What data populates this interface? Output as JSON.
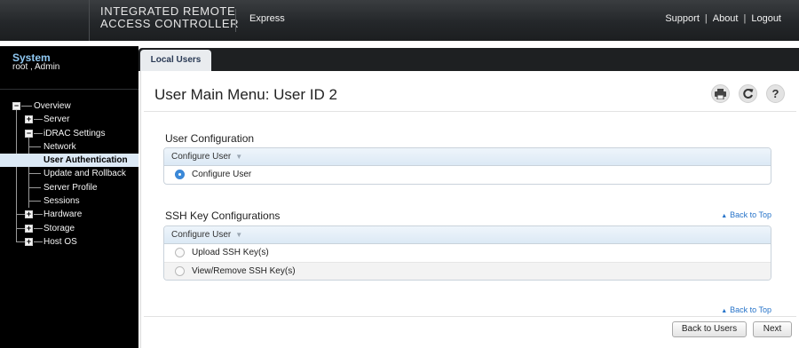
{
  "header": {
    "brand_line1": "INTEGRATED REMOTE",
    "brand_line2": "ACCESS CONTROLLER",
    "product": "Express",
    "links": {
      "support": "Support",
      "about": "About",
      "logout": "Logout",
      "separator": "|"
    }
  },
  "sidebar": {
    "title": "System",
    "user": "root , Admin",
    "tree": [
      {
        "label": "Overview",
        "expander": "−",
        "selected": false
      },
      {
        "label": "Server",
        "expander": "+",
        "selected": false
      },
      {
        "label": "iDRAC Settings",
        "expander": "−",
        "selected": false
      },
      {
        "label": "Network",
        "expander": "",
        "selected": false
      },
      {
        "label": "User Authentication",
        "expander": "",
        "selected": true
      },
      {
        "label": "Update and Rollback",
        "expander": "",
        "selected": false
      },
      {
        "label": "Server Profile",
        "expander": "",
        "selected": false
      },
      {
        "label": "Sessions",
        "expander": "",
        "selected": false
      },
      {
        "label": "Hardware",
        "expander": "+",
        "selected": false
      },
      {
        "label": "Storage",
        "expander": "+",
        "selected": false
      },
      {
        "label": "Host OS",
        "expander": "+",
        "selected": false
      }
    ]
  },
  "tabs": [
    {
      "label": "Local Users"
    }
  ],
  "main": {
    "title": "User Main Menu: User ID 2",
    "toolbar": {
      "print_icon": "printer-icon",
      "refresh_icon": "refresh-icon",
      "help_icon": "help-icon",
      "help_glyph": "?"
    },
    "user_config": {
      "title": "User Configuration",
      "column_header": "Configure User",
      "options": [
        {
          "label": "Configure User",
          "checked": true
        }
      ]
    },
    "ssh_config": {
      "title": "SSH Key Configurations",
      "back_to_top": "Back to Top",
      "column_header": "Configure User",
      "options": [
        {
          "label": "Upload SSH Key(s)",
          "checked": false
        },
        {
          "label": "View/Remove SSH Key(s)",
          "checked": false
        }
      ]
    },
    "bottom_back_to_top": "Back to Top",
    "buttons": {
      "back": "Back to Users",
      "next": "Next"
    }
  },
  "colors": {
    "accent": "#3b8ad9",
    "link": "#2673c9",
    "sidebar_title": "#8fc8f2",
    "selected_row": "#dce9f6"
  }
}
